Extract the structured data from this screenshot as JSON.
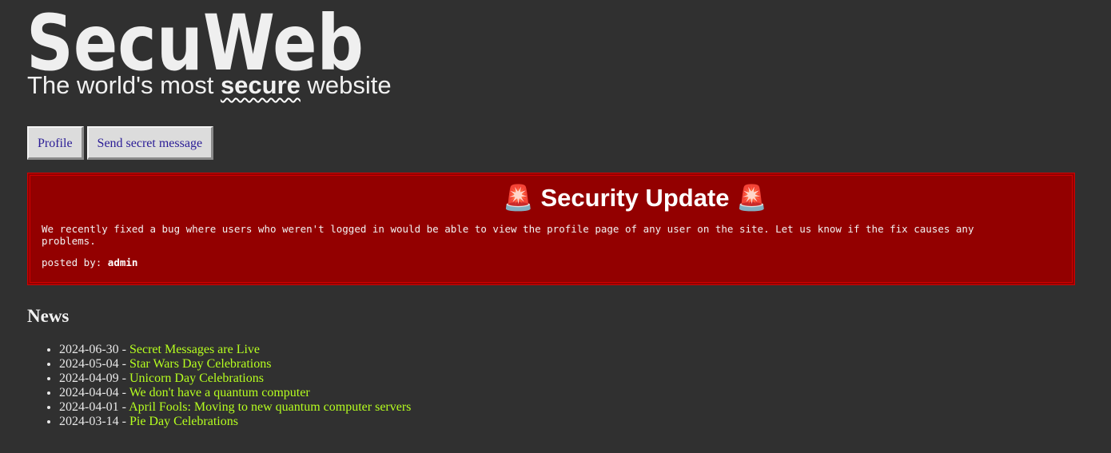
{
  "brand": {
    "logo_text": "SecuWeb",
    "tagline_prefix": "The world's most ",
    "tagline_emphasis": "secure",
    "tagline_suffix": " website"
  },
  "nav": {
    "profile_label": "Profile",
    "send_message_label": "Send secret message"
  },
  "alert": {
    "icon": "siren-icon",
    "title": "Security Update",
    "body": "We recently fixed a bug where users who weren't logged in would be able to view the profile page of any user on the site. Let us know if the fix causes any problems.",
    "posted_by_label": "posted by:",
    "author": "admin"
  },
  "news": {
    "heading": "News",
    "items": [
      {
        "date": "2024-06-30",
        "title": "Secret Messages are Live"
      },
      {
        "date": "2024-05-04",
        "title": "Star Wars Day Celebrations"
      },
      {
        "date": "2024-04-09",
        "title": "Unicorn Day Celebrations"
      },
      {
        "date": "2024-04-04",
        "title": "We don't have a quantum computer"
      },
      {
        "date": "2024-04-01",
        "title": "April Fools: Moving to new quantum computer servers"
      },
      {
        "date": "2024-03-14",
        "title": "Pie Day Celebrations"
      }
    ]
  },
  "colors": {
    "page_background": "#303030",
    "alert_background": "#930000",
    "alert_border": "#d00000",
    "news_link": "#b6ff1f",
    "nav_button": "#dcdcdc",
    "nav_text": "#2a1c96"
  }
}
